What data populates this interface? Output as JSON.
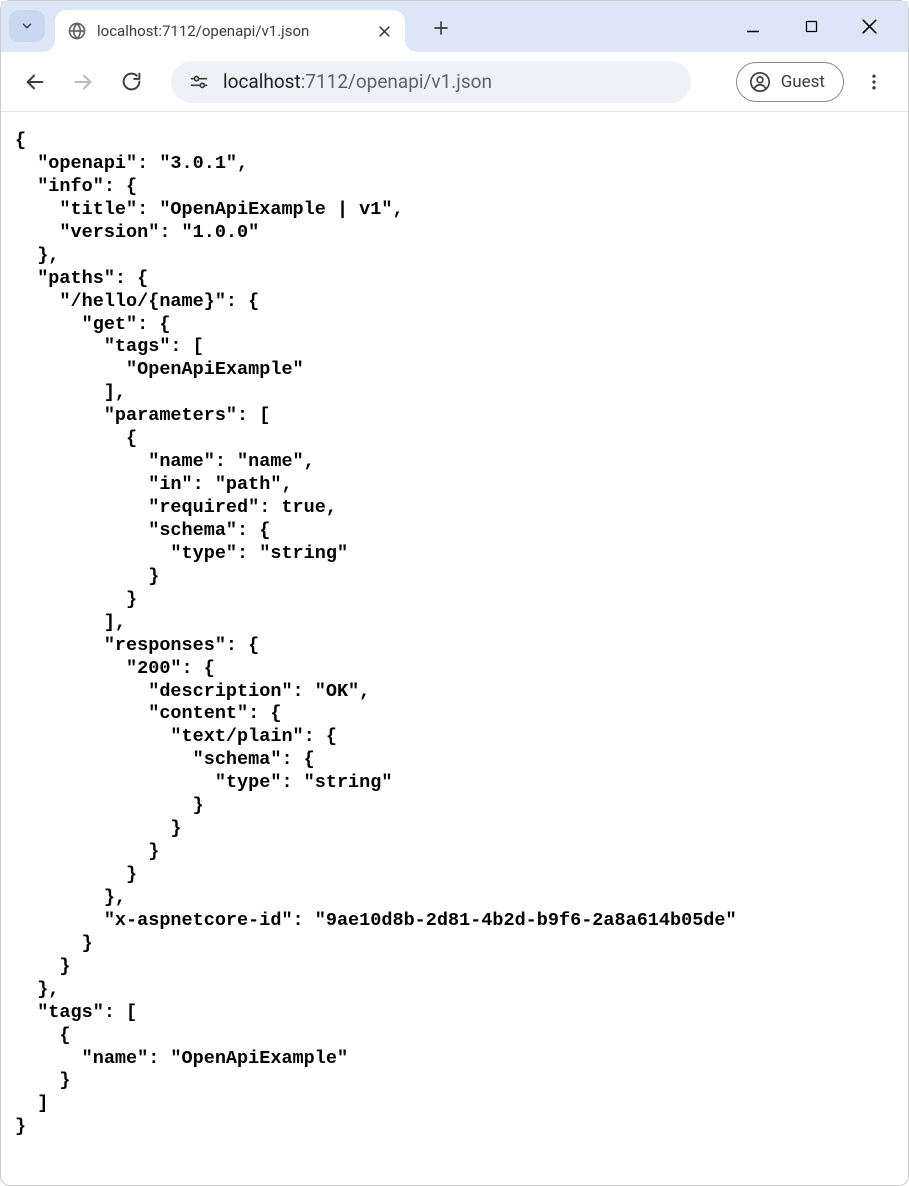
{
  "tab": {
    "title": "localhost:7112/openapi/v1.json"
  },
  "address": {
    "host": "localhost",
    "port_path": ":7112/openapi/v1.json"
  },
  "profile": {
    "label": "Guest"
  },
  "json_body": "{\n  \"openapi\": \"3.0.1\",\n  \"info\": {\n    \"title\": \"OpenApiExample | v1\",\n    \"version\": \"1.0.0\"\n  },\n  \"paths\": {\n    \"/hello/{name}\": {\n      \"get\": {\n        \"tags\": [\n          \"OpenApiExample\"\n        ],\n        \"parameters\": [\n          {\n            \"name\": \"name\",\n            \"in\": \"path\",\n            \"required\": true,\n            \"schema\": {\n              \"type\": \"string\"\n            }\n          }\n        ],\n        \"responses\": {\n          \"200\": {\n            \"description\": \"OK\",\n            \"content\": {\n              \"text/plain\": {\n                \"schema\": {\n                  \"type\": \"string\"\n                }\n              }\n            }\n          }\n        },\n        \"x-aspnetcore-id\": \"9ae10d8b-2d81-4b2d-b9f6-2a8a614b05de\"\n      }\n    }\n  },\n  \"tags\": [\n    {\n      \"name\": \"OpenApiExample\"\n    }\n  ]\n}"
}
